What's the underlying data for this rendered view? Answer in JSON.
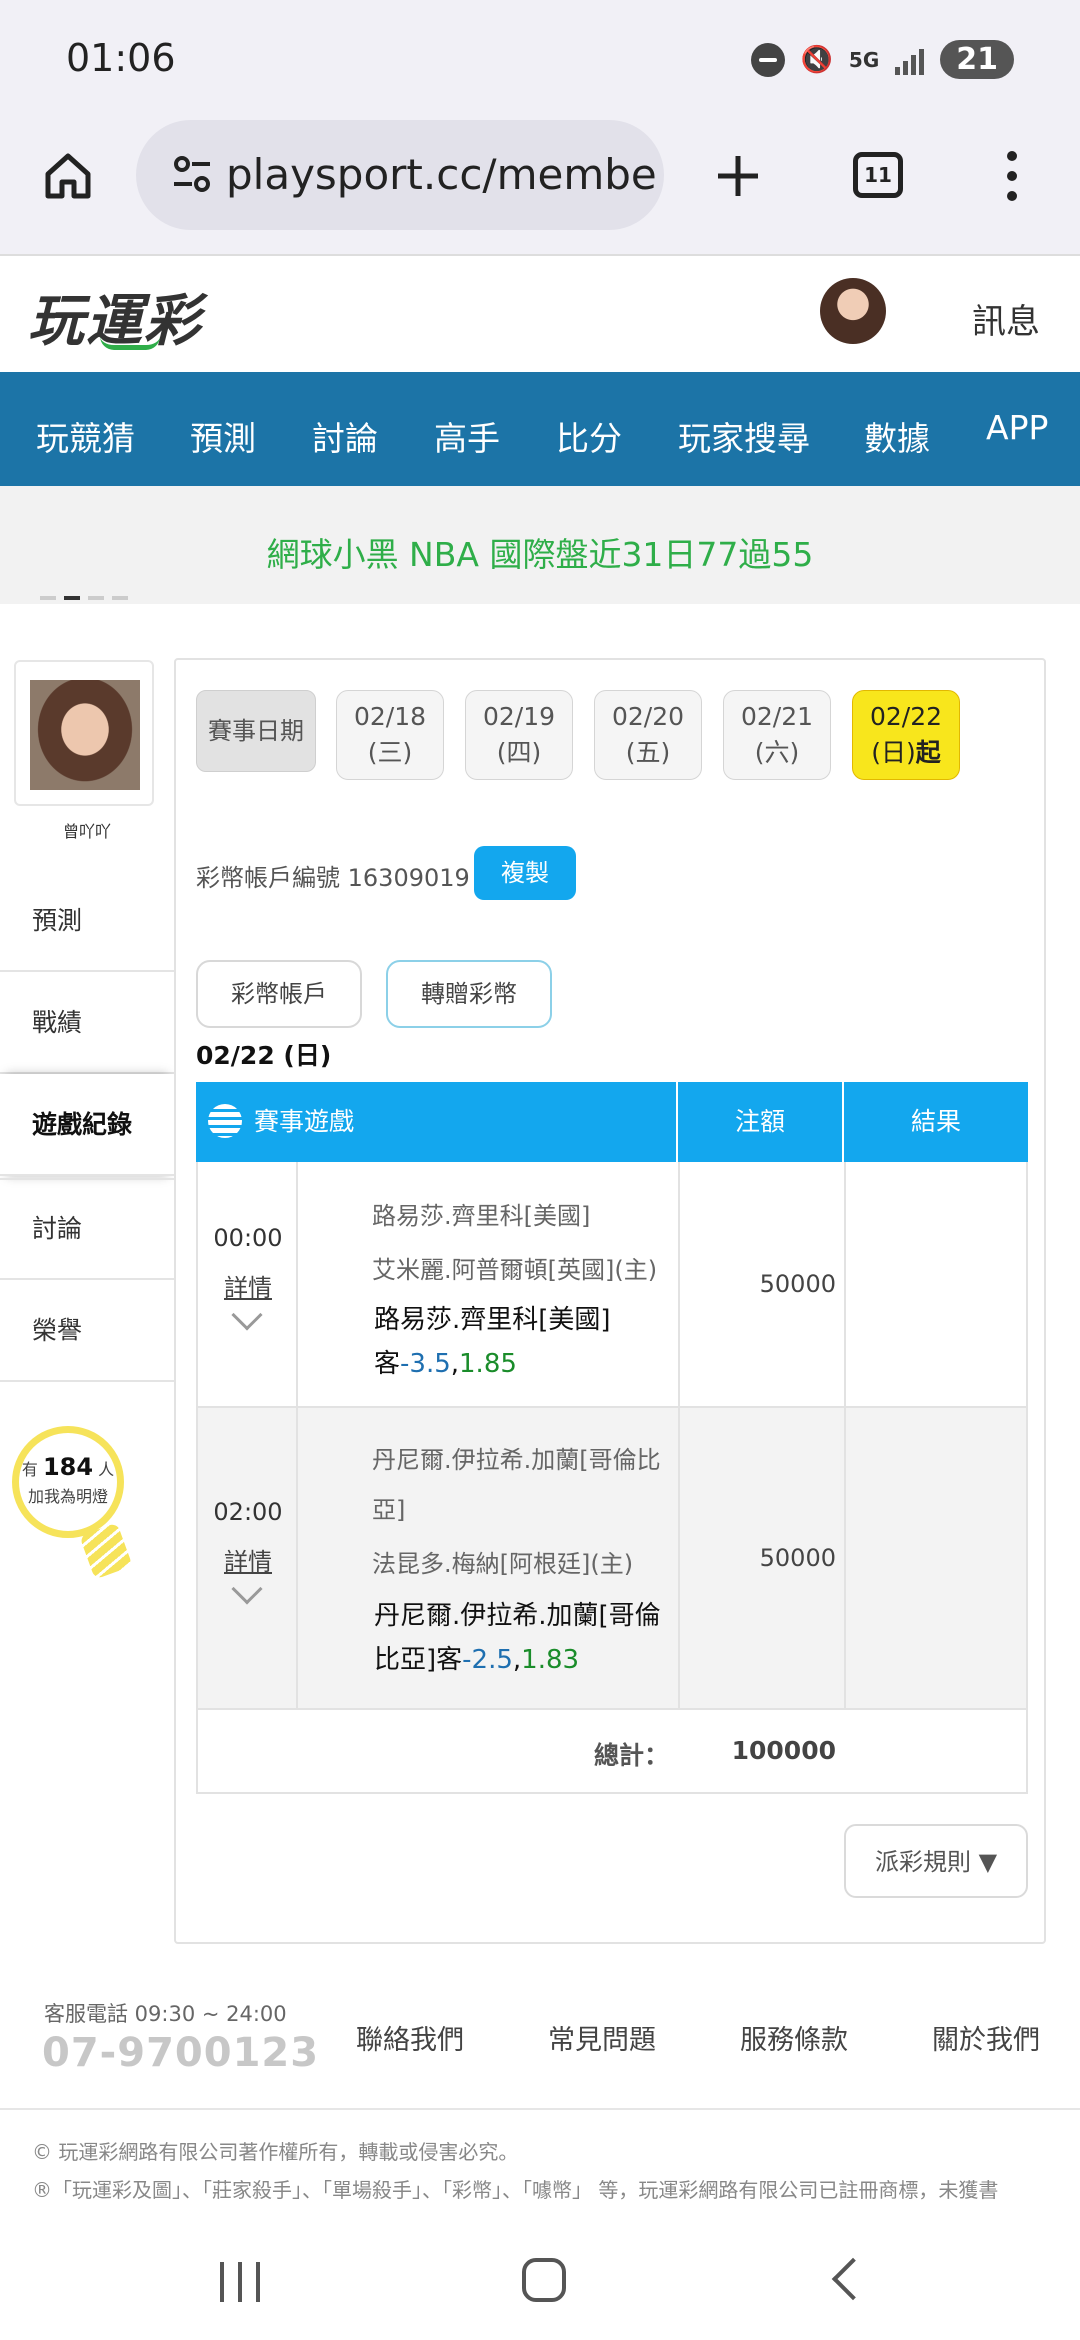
{
  "status": {
    "time": "01:06",
    "network": "5G",
    "notification_count": "21"
  },
  "browser": {
    "url": "playsport.cc/membe",
    "tab_count": "11"
  },
  "header": {
    "logo_text": "玩運彩",
    "messages_label": "訊息"
  },
  "nav": [
    "玩競猜",
    "預測",
    "討論",
    "高手",
    "比分",
    "玩家搜尋",
    "數據",
    "APP"
  ],
  "marquee": {
    "text": "網球小黑 NBA 國際盤近31日77過55"
  },
  "sidebar": {
    "username": "曾吖吖",
    "items": [
      {
        "label": "預測"
      },
      {
        "label": "戰績"
      },
      {
        "label": "遊戲紀錄",
        "active": true
      },
      {
        "label": "討論"
      },
      {
        "label": "榮譽"
      }
    ],
    "witness": {
      "prefix": "有",
      "count": "184",
      "unit": "人",
      "line2": "加我為明燈"
    }
  },
  "dates": {
    "label": "賽事日期",
    "chips": [
      {
        "date": "02/18",
        "dow": "(三)"
      },
      {
        "date": "02/19",
        "dow": "(四)"
      },
      {
        "date": "02/20",
        "dow": "(五)"
      },
      {
        "date": "02/21",
        "dow": "(六)"
      },
      {
        "date": "02/22",
        "dow": "(日)",
        "suffix": "起",
        "selected": true
      }
    ]
  },
  "account": {
    "label": "彩幣帳戶編號",
    "number": "16309019",
    "copy_label": "複製"
  },
  "tabs": {
    "account": "彩幣帳戶",
    "transfer": "轉贈彩幣"
  },
  "day_title": "02/22 (日)",
  "table": {
    "headers": {
      "game": "賽事遊戲",
      "amount": "注額",
      "result": "結果"
    },
    "rows": [
      {
        "time": "00:00",
        "detail": "詳情",
        "away": "路易莎.齊里科[美國]",
        "home": "艾米麗.阿普爾頓[英國](主)",
        "pick_line1": "路易莎.齊里科[美國]",
        "pick_side": "客",
        "pick_num": "-3.5",
        "pick_sep": ",",
        "pick_odds": "1.85",
        "amount": "50000",
        "result": ""
      },
      {
        "time": "02:00",
        "detail": "詳情",
        "away_l1": "丹尼爾.伊拉希.加蘭[哥倫比",
        "away_l2": "亞]",
        "home": "法昆多.梅納[阿根廷](主)",
        "pick_line1": "丹尼爾.伊拉希.加蘭[哥倫",
        "pick_line2a": "比亞]",
        "pick_side": "客",
        "pick_num": "-2.5",
        "pick_sep": ",",
        "pick_odds": "1.83",
        "amount": "50000",
        "result": ""
      }
    ],
    "total_label": "總計：",
    "total_value": "100000"
  },
  "rules_button": "派彩規則 ▼",
  "footer": {
    "service_hours": "客服電話 09:30 ~ 24:00",
    "phone": "07-9700123",
    "links": [
      "聯絡我們",
      "常見問題",
      "服務條款",
      "關於我們"
    ],
    "copyright": "© 玩運彩網路有限公司著作權所有，轉載或侵害必究。",
    "trademark": "®「玩運彩及圖」、「莊家殺手」、「單場殺手」、「彩幣」、「噱幣」 等，玩運彩網路有限公司已註冊商標，未獲書"
  },
  "colors": {
    "nav_bg": "#1c74a7",
    "accent_blue": "#13a7ee",
    "marquee_green": "#2fae49",
    "selected_yellow": "#f8e61c"
  }
}
